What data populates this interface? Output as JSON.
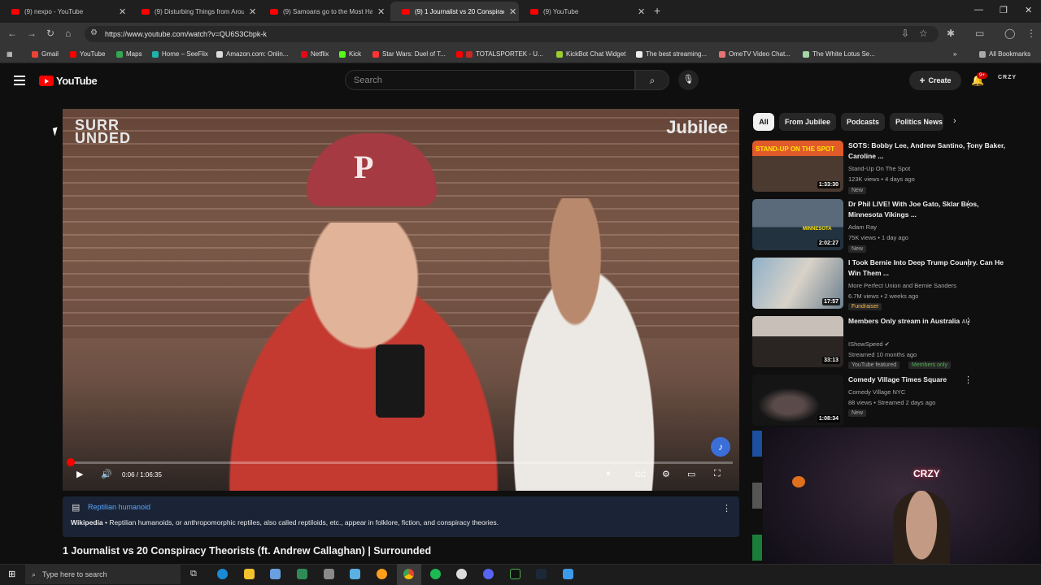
{
  "browser": {
    "tabs": [
      {
        "title": "(9) nexpo - YouTube"
      },
      {
        "title": "(9) Disturbing Things from Arou"
      },
      {
        "title": "(9) Samoans go to the Most Ha"
      },
      {
        "title": "(9) 1 Journalist vs 20 Conspirac"
      },
      {
        "title": "(9) YouTube"
      }
    ],
    "url": "https://www.youtube.com/watch?v=QU6S3Cbpk-k",
    "bookmarks": [
      "Gmail",
      "YouTube",
      "Maps",
      "Home – SeeFlix",
      "Amazon.com: Onlin...",
      "Netflix",
      "Kick",
      "Star Wars: Duel of T...",
      "TOTALSPORTEK - U...",
      "KickBot Chat Widget",
      "The best streaming...",
      "OmeTV Video Chat...",
      "The White Lotus Se..."
    ],
    "all_bookmarks": "All Bookmarks",
    "colors": {
      "tab_bg": "#1f1f1f",
      "toolbar": "#353535",
      "youtube_red": "#ff0000"
    }
  },
  "youtube": {
    "logo": "YouTube",
    "search_placeholder": "Search",
    "create_label": "Create",
    "notif_badge": "9+",
    "avatar": "CRZY"
  },
  "player": {
    "watermark_left": "SURR UNDED",
    "watermark_right": "Jubilee",
    "time": "0:06 / 1:06:35",
    "progress_fraction": 0.0015
  },
  "info_panel": {
    "heading": "Reptilian humanoid",
    "source": "Wikipedia",
    "text": "Reptilian humanoids, or anthropomorphic reptiles, also called reptiloids, etc., appear in folklore, fiction, and conspiracy theories."
  },
  "video_title": "1 Journalist vs 20 Conspiracy Theorists (ft. Andrew Callaghan) | Surrounded",
  "chips": [
    "All",
    "From Jubilee",
    "Podcasts",
    "Politics News"
  ],
  "recommendations": [
    {
      "title": "SOTS: Bobby Lee, Andrew Santino, Tony Baker, Caroline ...",
      "channel": "Stand-Up On The Spot",
      "meta": "123K views • 4 days ago",
      "tag": "New",
      "duration": "1:33:30",
      "thumb_text": "STAND-UP ON THE SPOT"
    },
    {
      "title": "Dr Phil LIVE! With Joe Gato, Sklar Bros, Minnesota Vikings ...",
      "channel": "Adam Ray",
      "meta": "75K views • 1 day ago",
      "tag": "New",
      "duration": "2:02:27",
      "thumb_text": "MINNESOTA"
    },
    {
      "title": "I Took Bernie Into Deep Trump Country. Can He Win Them ...",
      "channel": "More Perfect Union and Bernie Sanders",
      "meta": "6.7M views • 2 weeks ago",
      "tag": "Fundraiser",
      "duration": "17:57",
      "thumb_text": ""
    },
    {
      "title": "Members Only stream in Australia",
      "title_suffix": "AU",
      "channel": "IShowSpeed",
      "meta": "Streamed 10 months ago",
      "tag": "YouTube featured",
      "tag2": "Members only",
      "duration": "33:13",
      "thumb_text": ""
    },
    {
      "title": "Comedy Village Times Square",
      "channel": "Comedy Village NYC",
      "meta": "88 views • Streamed 2 days ago",
      "tag": "New",
      "duration": "1:08:34",
      "thumb_text": ""
    }
  ],
  "webcam": {
    "sign": "CRZY"
  },
  "taskbar": {
    "search_placeholder": "Type here to search"
  }
}
